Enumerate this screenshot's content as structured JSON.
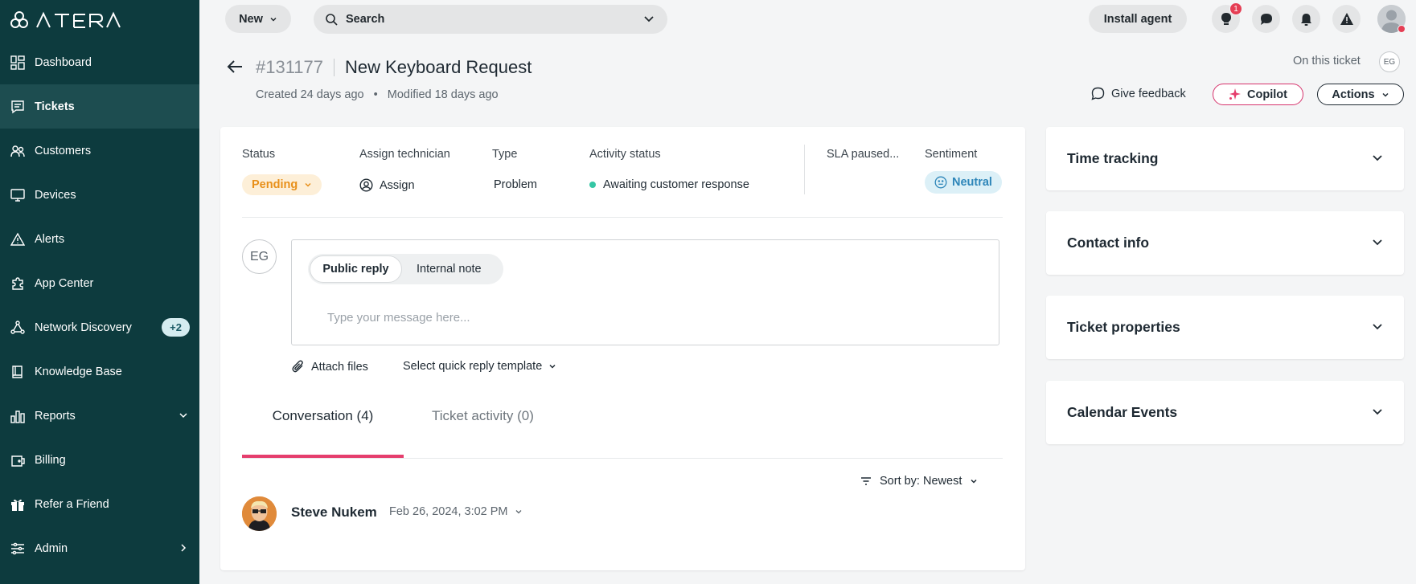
{
  "app": {
    "logo": "ATERA"
  },
  "sidebar": {
    "items": [
      {
        "label": "Dashboard",
        "icon": "dashboard-icon"
      },
      {
        "label": "Tickets",
        "icon": "tickets-icon",
        "active": true
      },
      {
        "label": "Customers",
        "icon": "customers-icon"
      },
      {
        "label": "Devices",
        "icon": "devices-icon"
      },
      {
        "label": "Alerts",
        "icon": "alerts-icon"
      },
      {
        "label": "App Center",
        "icon": "puzzle-icon"
      },
      {
        "label": "Network Discovery",
        "icon": "network-icon",
        "badge": "+2"
      },
      {
        "label": "Knowledge Base",
        "icon": "book-icon"
      },
      {
        "label": "Reports",
        "icon": "reports-icon"
      },
      {
        "label": "Billing",
        "icon": "billing-icon"
      },
      {
        "label": "Refer a Friend",
        "icon": "gift-icon"
      },
      {
        "label": "Admin",
        "icon": "sliders-icon"
      }
    ]
  },
  "topbar": {
    "new_label": "New",
    "search_placeholder": "Search",
    "install_label": "Install agent",
    "notification_count": "1"
  },
  "ticket": {
    "number": "#131177",
    "title": "New Keyboard Request",
    "created": "Created 24 days ago",
    "separator": "•",
    "modified": "Modified 18 days ago",
    "on_this_ticket": "On this ticket",
    "viewer_initials": "EG",
    "give_feedback": "Give feedback",
    "copilot": "Copilot",
    "actions": "Actions"
  },
  "fields": {
    "status_label": "Status",
    "status_value": "Pending",
    "assign_label": "Assign technician",
    "assign_value": "Assign",
    "type_label": "Type",
    "type_value": "Problem",
    "activity_label": "Activity status",
    "activity_value": "Awaiting customer response",
    "sla_label": "SLA paused...",
    "sentiment_label": "Sentiment",
    "sentiment_value": "Neutral"
  },
  "reply": {
    "initials": "EG",
    "tab_public": "Public reply",
    "tab_internal": "Internal note",
    "placeholder": "Type your message here...",
    "attach": "Attach files",
    "template": "Select quick reply template"
  },
  "conversation": {
    "tab_conversation": "Conversation (4)",
    "tab_activity": "Ticket activity (0)",
    "sort_label": "Sort by:",
    "sort_value": "Newest",
    "message": {
      "author": "Steve Nukem",
      "date": "Feb 26, 2024, 3:02 PM"
    }
  },
  "panels": [
    {
      "title": "Time tracking"
    },
    {
      "title": "Contact info"
    },
    {
      "title": "Ticket properties"
    },
    {
      "title": "Calendar Events"
    }
  ],
  "colors": {
    "sidebar_bg": "#0d3b3e",
    "accent_pink": "#e53e6d",
    "pending": "#e8901a",
    "neutral": "#2e86b9"
  }
}
